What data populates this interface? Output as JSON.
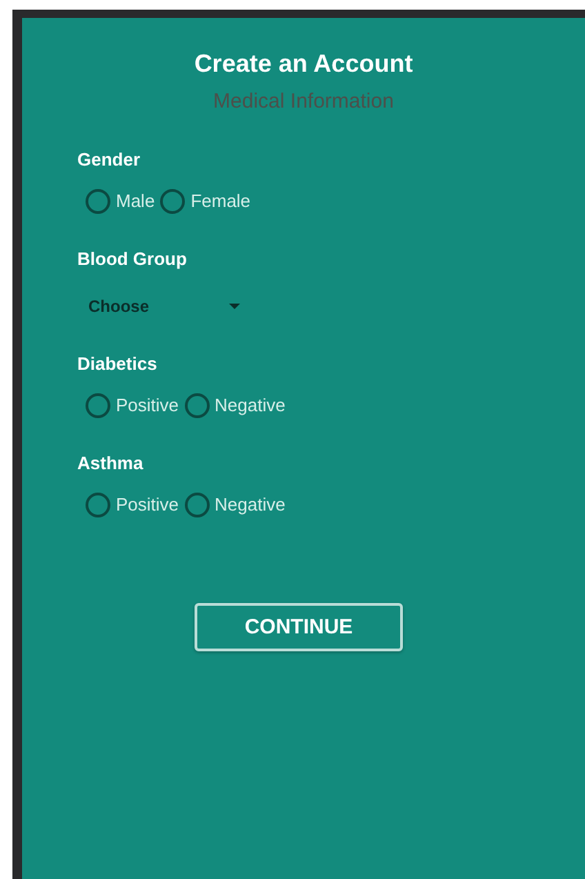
{
  "title": "Create an Account",
  "subtitle": "Medical Information",
  "fields": [
    {
      "kind": "radio",
      "label": "Gender",
      "options": [
        {
          "label": "Male",
          "selected": false
        },
        {
          "label": "Female",
          "selected": false
        }
      ]
    },
    {
      "kind": "select",
      "label": "Blood Group",
      "value": "Choose"
    },
    {
      "kind": "radio",
      "label": "Diabetics",
      "options": [
        {
          "label": "Positive",
          "selected": false
        },
        {
          "label": "Negative",
          "selected": false
        }
      ]
    },
    {
      "kind": "radio",
      "label": "Asthma",
      "options": [
        {
          "label": "Positive",
          "selected": false
        },
        {
          "label": "Negative",
          "selected": false
        }
      ]
    }
  ],
  "button": "CONTINUE"
}
